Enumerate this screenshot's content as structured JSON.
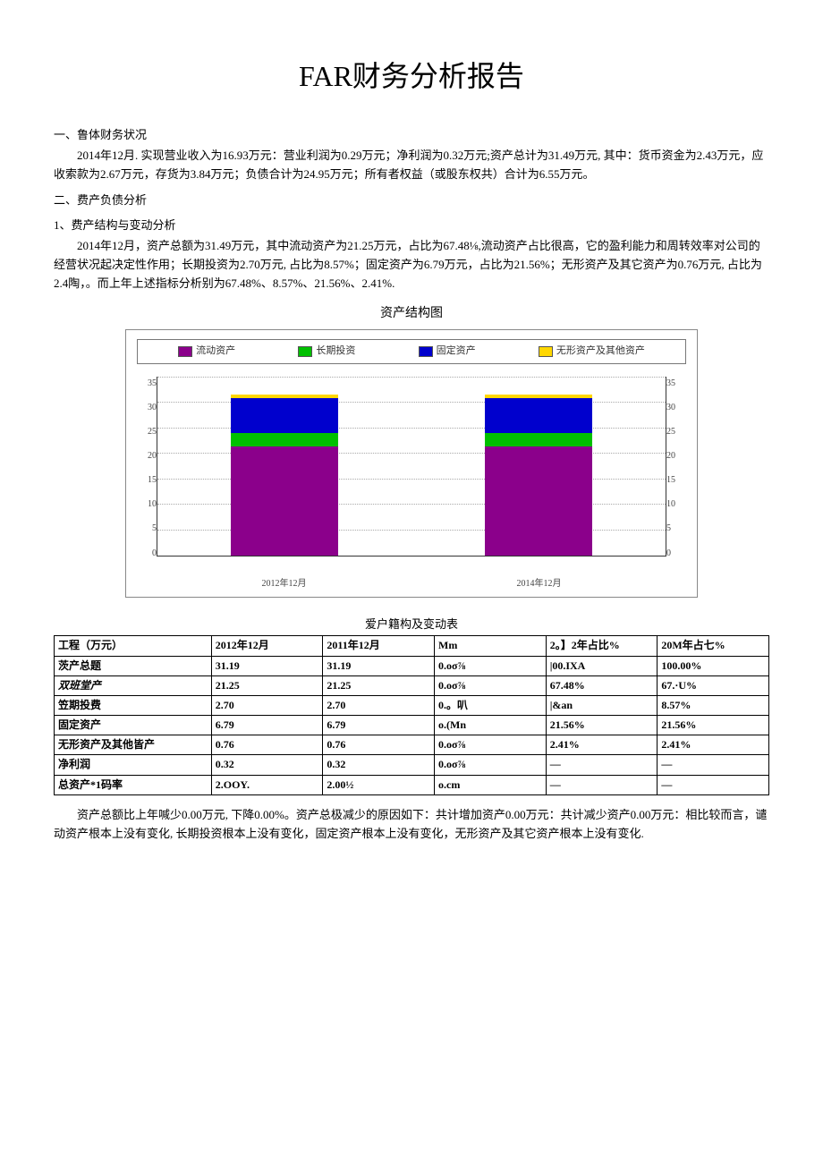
{
  "title": "FAR财务分析报告",
  "section1": {
    "heading": "一、鲁体财务状况",
    "text": "2014年12月. 实现营业收入为16.93万元：营业利润为0.29万元；净利润为0.32万元;资产总计为31.49万元, 其中：货币资金为2.43万元，应收索款为2.67万元，存货为3.84万元；负债合计为24.95万元；所有者权益（或股东权共）合计为6.55万元。"
  },
  "section2": {
    "heading": "二、费产负债分析",
    "sub1_heading": "1、费产结构与变动分析",
    "sub1_text": "2014年12月，资产总额为31.49万元，其中流动资产为21.25万元，占比为67.48⅛,流动资产占比很高，它的盈利能力和周转效率对公司的经营状况起决定性作用；长期投资为2.70万元, 占比为8.57%；固定资产为6.79万元，占比为21.56%；无形资产及其它资产为0.76万元, 占比为2.4陶，。而上年上述指标分析别为67.48%、8.57%、21.56%、2.41%."
  },
  "chart": {
    "title": "资产结构图",
    "legend": [
      "流动资产",
      "长期投资",
      "固定资产",
      "无形资产及其他资产"
    ],
    "colors": [
      "#8B008B",
      "#00C000",
      "#0000CD",
      "#FFD700"
    ],
    "ticks": [
      35,
      30,
      25,
      20,
      15,
      10,
      5,
      0
    ],
    "x_labels": [
      "2012年12月",
      "2014年12月"
    ]
  },
  "chart_data": {
    "type": "bar",
    "title": "资产结构图",
    "xlabel": "",
    "ylabel": "",
    "ylim": [
      0,
      35
    ],
    "categories": [
      "2012年12月",
      "2014年12月"
    ],
    "stacked": true,
    "series": [
      {
        "name": "流动资产",
        "values": [
          21.25,
          21.25
        ],
        "color": "#8B008B"
      },
      {
        "name": "长期投资",
        "values": [
          2.7,
          2.7
        ],
        "color": "#00C000"
      },
      {
        "name": "固定资产",
        "values": [
          6.79,
          6.79
        ],
        "color": "#0000CD"
      },
      {
        "name": "无形资产及其他资产",
        "values": [
          0.76,
          0.76
        ],
        "color": "#FFD700"
      }
    ]
  },
  "table": {
    "caption": "爱户籍构及变动表",
    "headers": [
      "工程（万元）",
      "2012年12月",
      "2011年12月",
      "Mm",
      "2。】2年占比%",
      "20M年占七%"
    ],
    "rows": [
      [
        "茨产总题",
        "31.19",
        "31.19",
        "0.oσ⅞",
        "|00.IXA",
        "100.00%"
      ],
      [
        "双班堂产",
        "21.25",
        "21.25",
        "0.oσ⅞",
        "67.48%",
        "67.·U%"
      ],
      [
        "笠期投费",
        "2.70",
        "2.70",
        "0.。叭",
        "|&an",
        "8.57%"
      ],
      [
        "固定资产",
        "6.79",
        "6.79",
        "o.(Mn",
        "21.56%",
        "21.56%"
      ],
      [
        "无形资产及其他皆产",
        "0.76",
        "0.76",
        "0.oσ⅞",
        "2.41%",
        "2.41%"
      ],
      [
        "净利润",
        "0.32",
        "0.32",
        "0.oσ⅞",
        "—",
        "—"
      ],
      [
        "总资产*1码率",
        "2.OOY.",
        "2.00½",
        "o.cm",
        "—",
        "—"
      ]
    ]
  },
  "footer_text": "资产总额比上年喊少0.00万元, 下降0.00%。资产总极减少的原因如下：共计增加资产0.00万元：共计减少资产0.00万元：相比较而言，谴动资产根本上没有变化, 长期投资根本上没有变化，固定资产根本上没有变化，无形资产及其它资产根本上没有变化."
}
